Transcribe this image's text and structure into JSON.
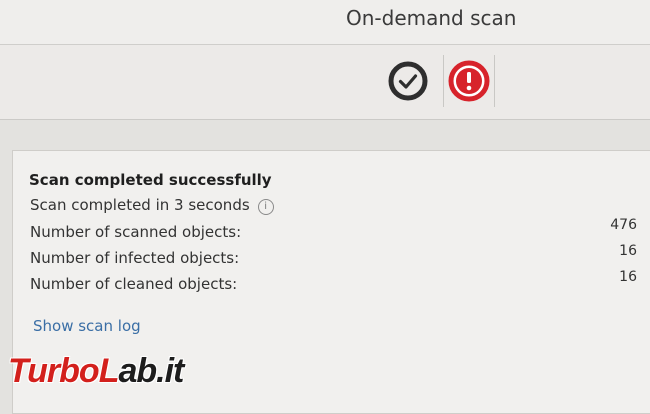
{
  "window": {
    "title": "On-demand scan"
  },
  "toolbar": {
    "buttons": [
      {
        "icon": "check-circle-icon",
        "color": "#2e2e2e"
      },
      {
        "icon": "alert-circle-icon",
        "color": "#d7232b"
      }
    ]
  },
  "result": {
    "heading": "Scan completed successfully",
    "duration_text": "Scan completed in 3 seconds",
    "stats": [
      {
        "label": "Number of scanned objects:",
        "value": "476"
      },
      {
        "label": "Number of infected objects:",
        "value": "16"
      },
      {
        "label": "Number of cleaned objects:",
        "value": "16"
      }
    ],
    "show_log_link": "Show scan log"
  },
  "watermark": {
    "part1": "TurboL",
    "part2": "ab.it"
  },
  "colors": {
    "link": "#3a6ea5",
    "alert": "#d7232b",
    "ok": "#2e2e2e"
  }
}
